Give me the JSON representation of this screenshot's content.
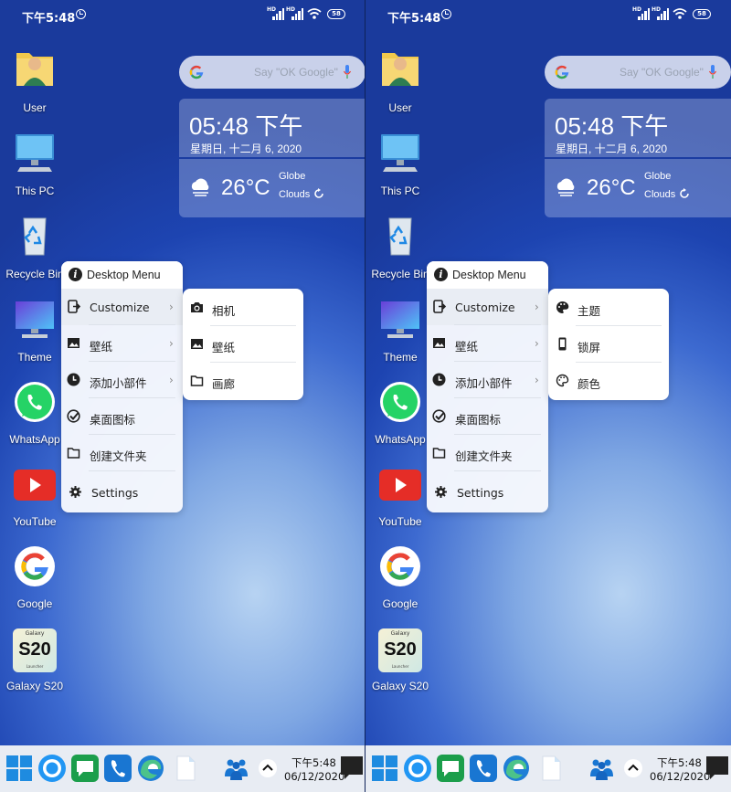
{
  "status": {
    "time": "下午5:48",
    "signal1": "HD",
    "signal2": "HD",
    "battery": "58"
  },
  "desktop_icons": [
    {
      "label": "User",
      "icon": "user-folder-icon"
    },
    {
      "label": "This PC",
      "icon": "computer-icon"
    },
    {
      "label": "Recycle Bin",
      "icon": "recycle-bin-icon"
    },
    {
      "label": "Theme",
      "icon": "theme-icon"
    },
    {
      "label": "WhatsApp",
      "icon": "whatsapp-icon"
    },
    {
      "label": "YouTube",
      "icon": "youtube-icon"
    },
    {
      "label": "Google",
      "icon": "google-icon"
    },
    {
      "label": "Galaxy S20",
      "icon": "galaxy-s20-icon",
      "badge_top": "Galaxy",
      "badge_main": "S20",
      "badge_bottom": "Launcher"
    }
  ],
  "search": {
    "placeholder": "Say \"OK Google\""
  },
  "clock_widget": {
    "time": "05:48 下午",
    "date": "星期日, 十二月 6, 2020"
  },
  "weather_widget": {
    "temp": "26°C",
    "location": "Globe",
    "condition": "Clouds"
  },
  "menu": {
    "title": "Desktop Menu",
    "items": [
      {
        "label": "Customize",
        "icon": "customize-icon",
        "submenu": true
      },
      {
        "label": "壁纸",
        "icon": "image-icon",
        "submenu": true
      },
      {
        "label": "添加小部件",
        "icon": "clock-icon",
        "submenu": true
      },
      {
        "label": "桌面图标",
        "icon": "check-circle-icon",
        "submenu": false
      },
      {
        "label": "创建文件夹",
        "icon": "folder-icon",
        "submenu": false
      },
      {
        "label": "Settings",
        "icon": "gear-icon",
        "submenu": false
      }
    ]
  },
  "submenu_left": [
    {
      "label": "相机",
      "icon": "camera-icon"
    },
    {
      "label": "壁纸",
      "icon": "image-icon"
    },
    {
      "label": "画廊",
      "icon": "folder-icon"
    }
  ],
  "submenu_right": [
    {
      "label": "主题",
      "icon": "palette-icon"
    },
    {
      "label": "锁屏",
      "icon": "phone-icon"
    },
    {
      "label": "颜色",
      "icon": "palette-outline-icon"
    }
  ],
  "taskbar": {
    "time": "下午5:48",
    "date": "06/12/2020"
  },
  "colors": {
    "accent": "#1976d2",
    "whatsapp": "#25d366",
    "youtube": "#e52d27",
    "menu_bg": "#f6f8fd"
  }
}
